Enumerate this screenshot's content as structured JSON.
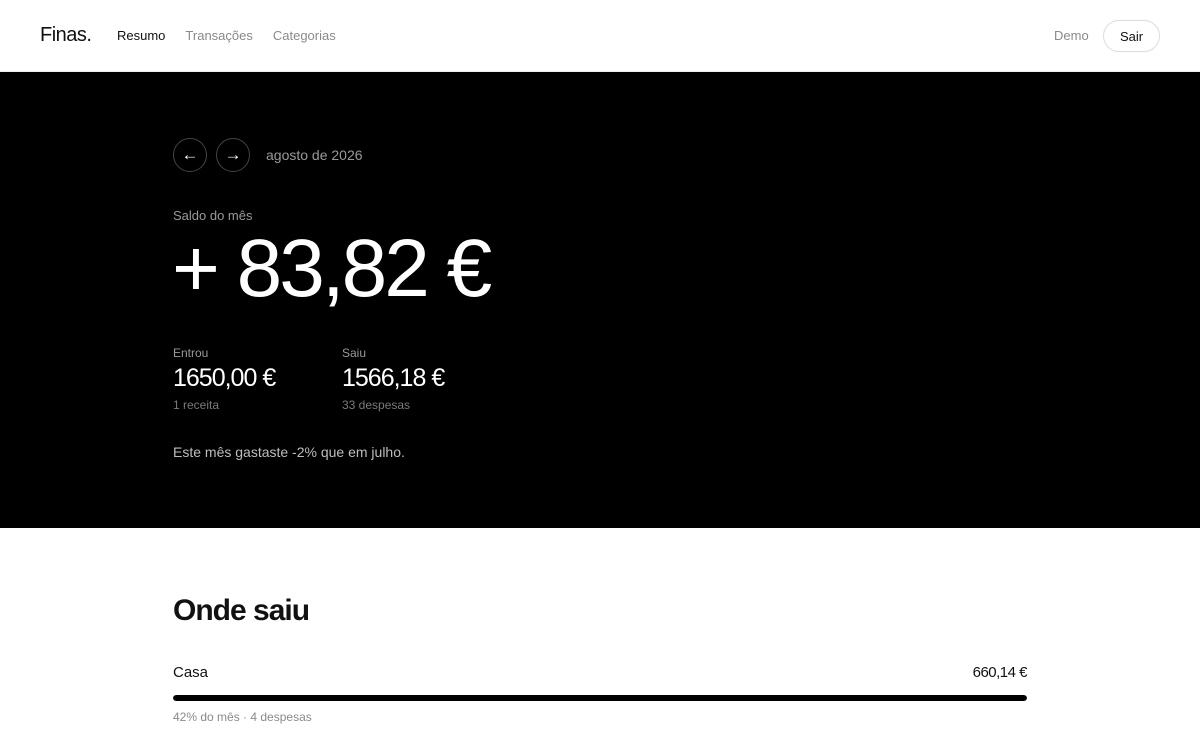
{
  "app": {
    "brand": "Finas",
    "brand_dot": ".",
    "nav": [
      {
        "label": "Resumo",
        "active": true
      },
      {
        "label": "Transações",
        "active": false
      },
      {
        "label": "Categorias",
        "active": false
      }
    ],
    "user": "Demo",
    "logout_label": "Sair"
  },
  "hero": {
    "prev_icon": "arrow-left-icon",
    "next_icon": "arrow-right-icon",
    "prev_glyph": "←",
    "next_glyph": "→",
    "month": "agosto de 2026",
    "saldo_label": "Saldo do mês",
    "saldo_value": "+ 83,82 €",
    "income": {
      "label": "Entrou",
      "value": "1650,00 €",
      "sub": "1 receita"
    },
    "expense": {
      "label": "Saiu",
      "value": "1566,18 €",
      "sub": "33 despesas"
    },
    "comparison": "Este mês gastaste -2% que em julho."
  },
  "breakdown": {
    "title": "Onde saiu",
    "categories": [
      {
        "name": "Casa",
        "amount": "660,14 €",
        "meta": "42% do mês · 4 despesas",
        "share": 1.0
      }
    ]
  },
  "colors": {
    "hero_bg": "#000000",
    "accent": "#000000",
    "muted": "#8a8a8a"
  }
}
